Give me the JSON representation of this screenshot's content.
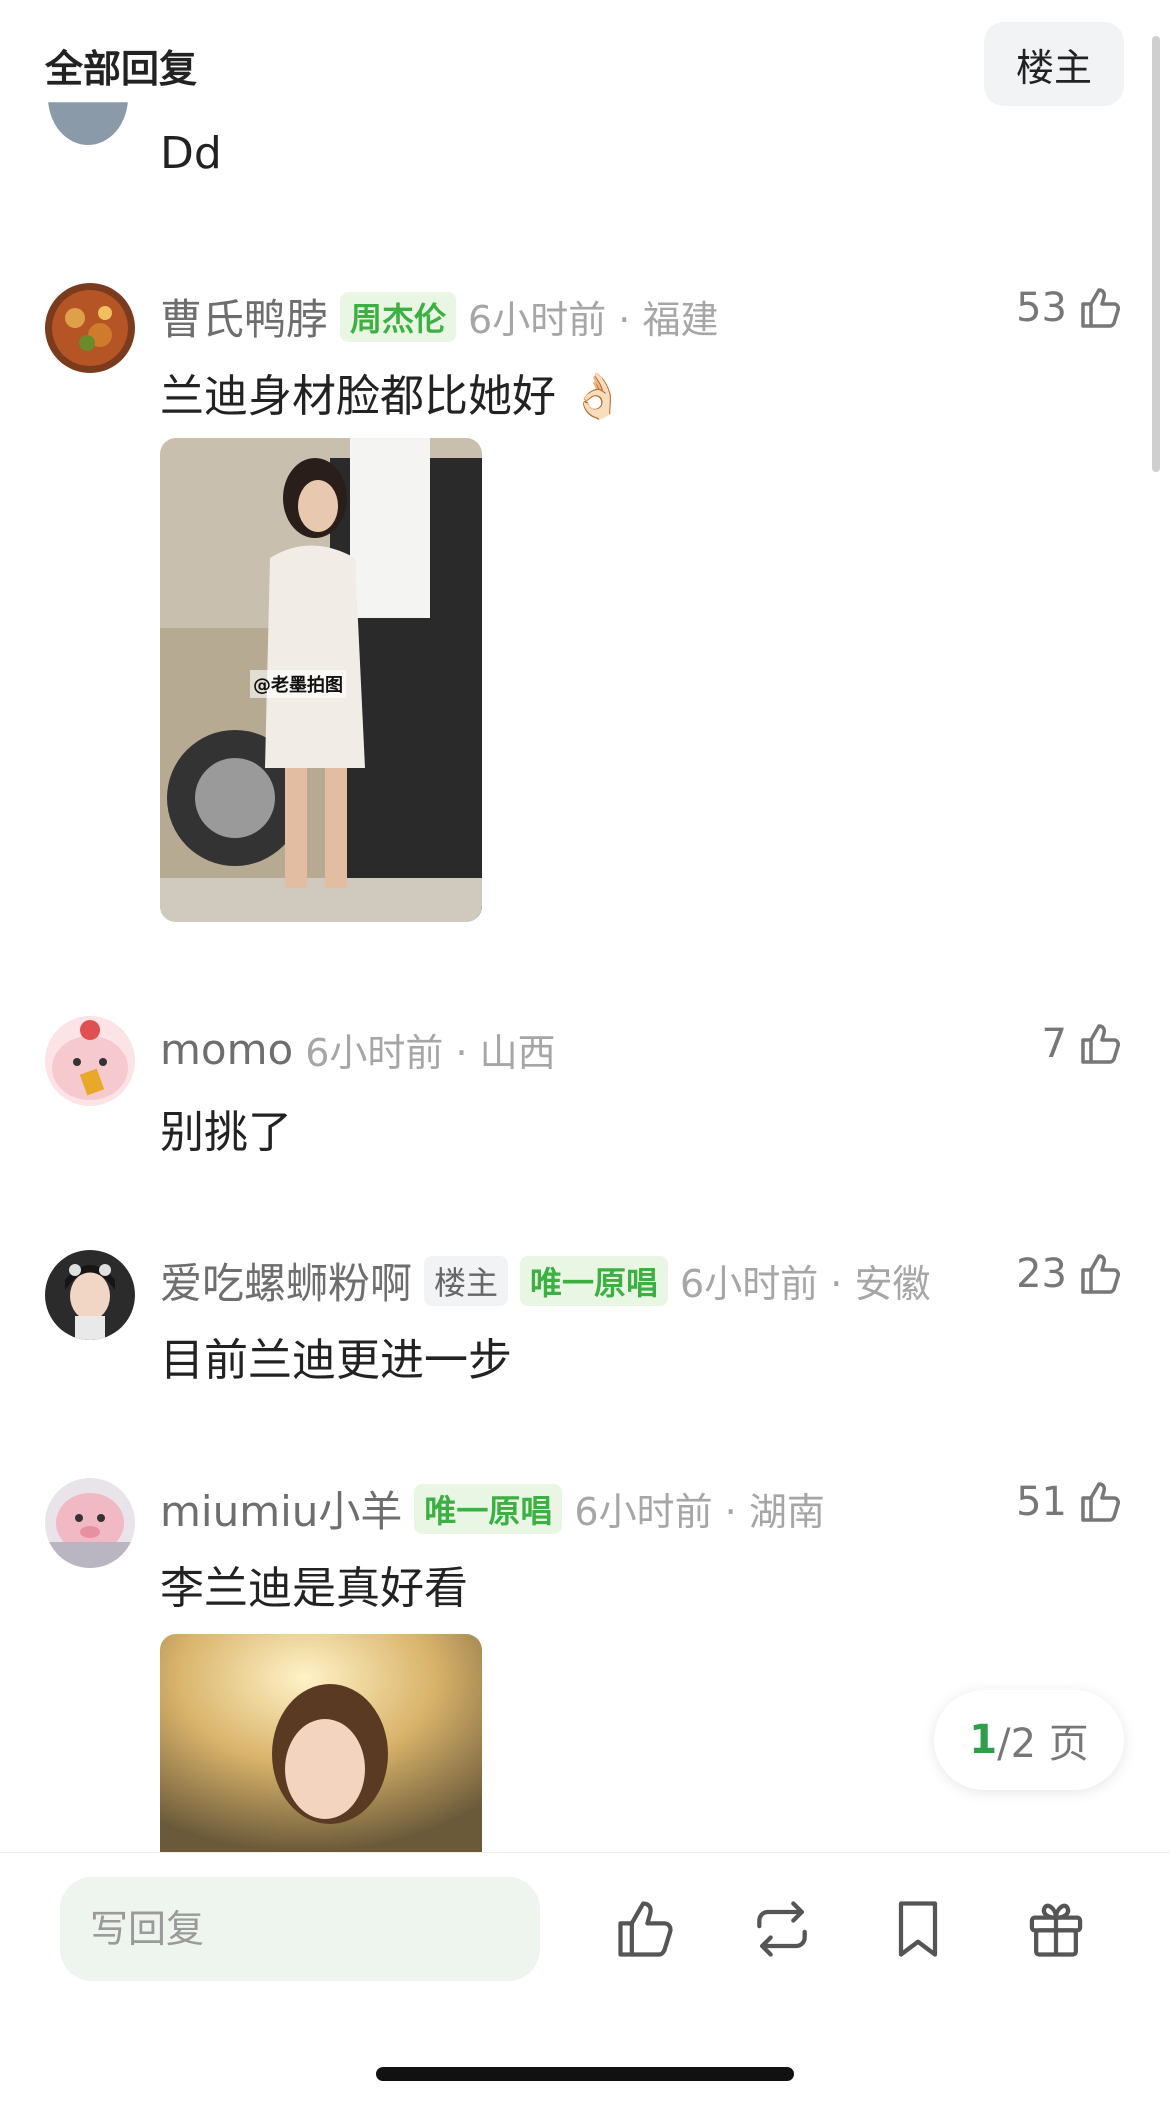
{
  "header": {
    "title": "全部回复",
    "owner_button": "楼主"
  },
  "comments": [
    {
      "text": "Dd"
    },
    {
      "username": "曹氏鸭脖",
      "badges": [
        "周杰伦"
      ],
      "meta": "6小时前 · 福建",
      "likes": "53",
      "text": "兰迪身材脸都比她好 👌🏻",
      "image": {
        "watermark": "@老墨拍图"
      }
    },
    {
      "username": "momo",
      "meta": "6小时前 · 山西",
      "likes": "7",
      "text": "别挑了"
    },
    {
      "username": "爱吃螺蛳粉啊",
      "badges": [
        "楼主",
        "唯一原唱"
      ],
      "meta": "6小时前 · 安徽",
      "likes": "23",
      "text": "目前兰迪更进一步"
    },
    {
      "username": "miumiu小羊",
      "badges": [
        "唯一原唱"
      ],
      "meta": "6小时前 · 湖南",
      "likes": "51",
      "text": "李兰迪是真好看"
    }
  ],
  "pagination": {
    "current": "1",
    "total_label": "/2 页"
  },
  "bottom_bar": {
    "reply_placeholder": "写回复",
    "icons": [
      "like-icon",
      "repost-icon",
      "bookmark-icon",
      "gift-icon"
    ]
  },
  "colors": {
    "badge_green": "#3cb043",
    "page_accent": "#2e9e4a",
    "input_bg": "#eef5ee"
  }
}
